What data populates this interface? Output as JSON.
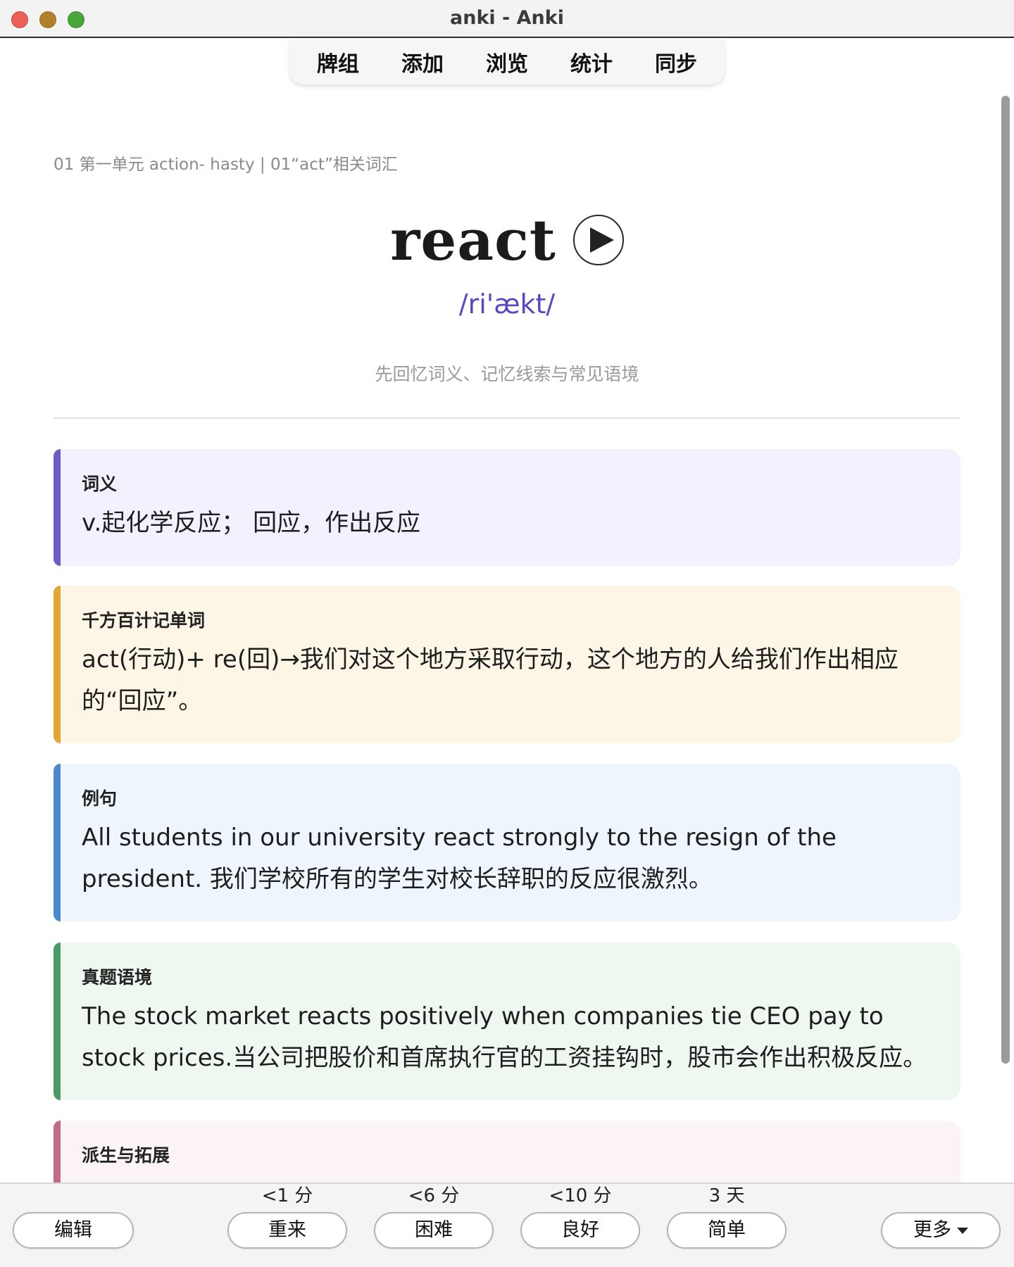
{
  "window": {
    "title": "anki - Anki"
  },
  "topnav": [
    "牌组",
    "添加",
    "浏览",
    "统计",
    "同步"
  ],
  "card": {
    "breadcrumb": "01 第一单元 action- hasty | 01“act”相关词汇",
    "word": "react",
    "phonetic": "/ri'ækt/",
    "hint": "先回忆词义、记忆线索与常见语境",
    "sections": [
      {
        "label": "词义",
        "body": "v.起化学反应； 回应，作出反应"
      },
      {
        "label": "千方百计记单词",
        "body": "act(行动)+ re(回)→我们对这个地方采取行动，这个地方的人给我们作出相应的“回应”。"
      },
      {
        "label": "例句",
        "body": "All students in our university react strongly to the resign of the president. 我们学校所有的学生对校长辞职的反应很激烈。"
      },
      {
        "label": "真题语境",
        "body": "The stock market reacts positively when companies tie CEO pay to stock prices.当公司把股价和首席执行官的工资挂钩时，股市会作出积极反应。"
      },
      {
        "label": "派生与拓展",
        "body": ""
      }
    ]
  },
  "bottombar": {
    "edit": "编辑",
    "more": "更多",
    "answers": [
      {
        "timing": "<1 分",
        "label": "重来"
      },
      {
        "timing": "<6 分",
        "label": "困难"
      },
      {
        "timing": "<10 分",
        "label": "良好"
      },
      {
        "timing": "3 天",
        "label": "简单"
      }
    ]
  },
  "colors": {
    "phonetic": "#5b46c4",
    "meaning_accent": "#6f5ac6",
    "memory_accent": "#e0a532",
    "example_accent": "#4b89cf",
    "exam_accent": "#4a9a66",
    "derivation_accent": "#c06a8a"
  },
  "icons": {
    "play": "play-icon",
    "more_caret": "chevron-down-icon"
  }
}
